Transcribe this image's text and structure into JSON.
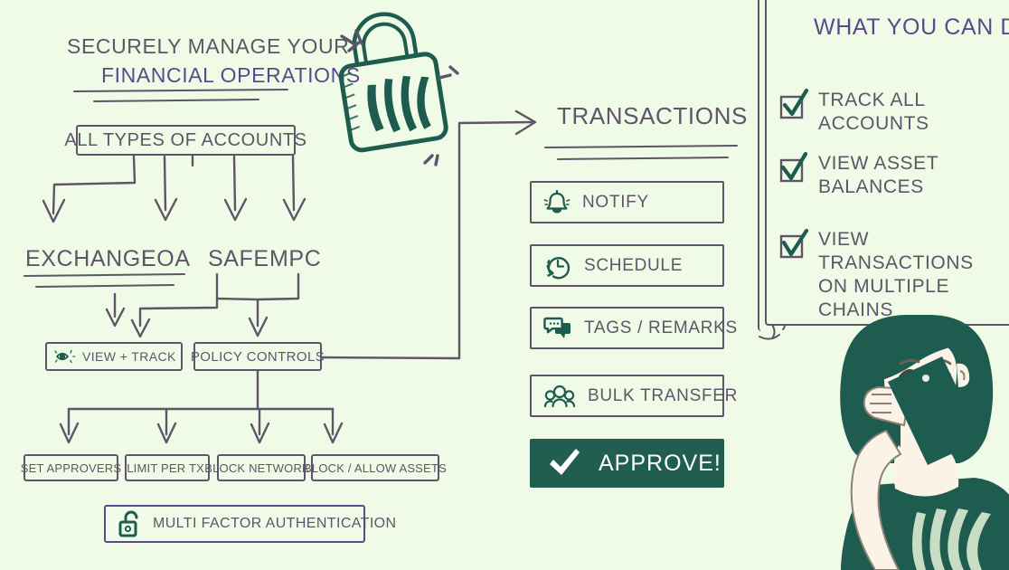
{
  "background_color": "#f0fbe7",
  "colors": {
    "ink_purple_gray": "#5f5468",
    "accent_purple": "#5a4a8c",
    "brand_green": "#215e50",
    "panel_bg": "#f0fbe7"
  },
  "headline": {
    "line1": "SECURELY MANAGE YOUR",
    "line2": "FINANCIAL OPERATIONS"
  },
  "accounts": {
    "box_label": "ALL TYPES OF ACCOUNTS",
    "types": [
      "EXCHANGE",
      "EOA",
      "SAFE",
      "MPC"
    ]
  },
  "controls": {
    "view_track": "VIEW + TRACK",
    "view_track_icon": "eye-icon",
    "policy_controls": "POLICY CONTROLS",
    "policy_items": [
      "SET APPROVERS",
      "LIMIT PER TX.",
      "BLOCK NETWORKS",
      "BLOCK / ALLOW ASSETS"
    ],
    "mfa": "MULTI FACTOR AUTHENTICATION",
    "mfa_icon": "open-padlock-icon"
  },
  "transactions": {
    "heading": "TRANSACTIONS",
    "actions": [
      {
        "label": "NOTIFY",
        "icon": "bell-icon",
        "primary": false
      },
      {
        "label": "SCHEDULE",
        "icon": "clock-icon",
        "primary": false
      },
      {
        "label": "TAGS / REMARKS",
        "icon": "chat-icon",
        "primary": false
      },
      {
        "label": "BULK TRANSFER",
        "icon": "people-icon",
        "primary": false
      },
      {
        "label": "APPROVE!",
        "icon": "checkmark-icon",
        "primary": true
      }
    ]
  },
  "panel": {
    "heading": "WHAT YOU CAN DO:",
    "items": [
      {
        "line1": "TRACK ALL ACCOUNTS",
        "line2": ""
      },
      {
        "line1": "VIEW ASSET BALANCES",
        "line2": ""
      },
      {
        "line1": "VIEW TRANSACTIONS",
        "line2": "ON MULTIPLE CHAINS"
      }
    ]
  },
  "illustrations": {
    "padlock": "closed-padlock-icon",
    "person": "woman-with-phone-illustration"
  }
}
